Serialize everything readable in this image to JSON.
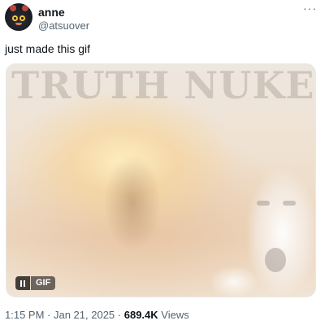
{
  "author": {
    "name": "anne",
    "handle": "@atsuover"
  },
  "more_menu": {
    "icon": "more-horizontal-icon",
    "glyph": "···"
  },
  "tweet": {
    "text": "just made this gif"
  },
  "media": {
    "overlay_text": "TRUTH NUKE",
    "badge_label": "GIF",
    "pause_icon": "pause-icon"
  },
  "meta": {
    "time": "1:15 PM",
    "separator1": " · ",
    "date": "Jan 21, 2025",
    "separator2": " · ",
    "views_count": "689.4K",
    "views_label": " Views"
  },
  "colors": {
    "text_primary": "#0f1419",
    "text_secondary": "#536471",
    "border": "#e6e9eb"
  }
}
